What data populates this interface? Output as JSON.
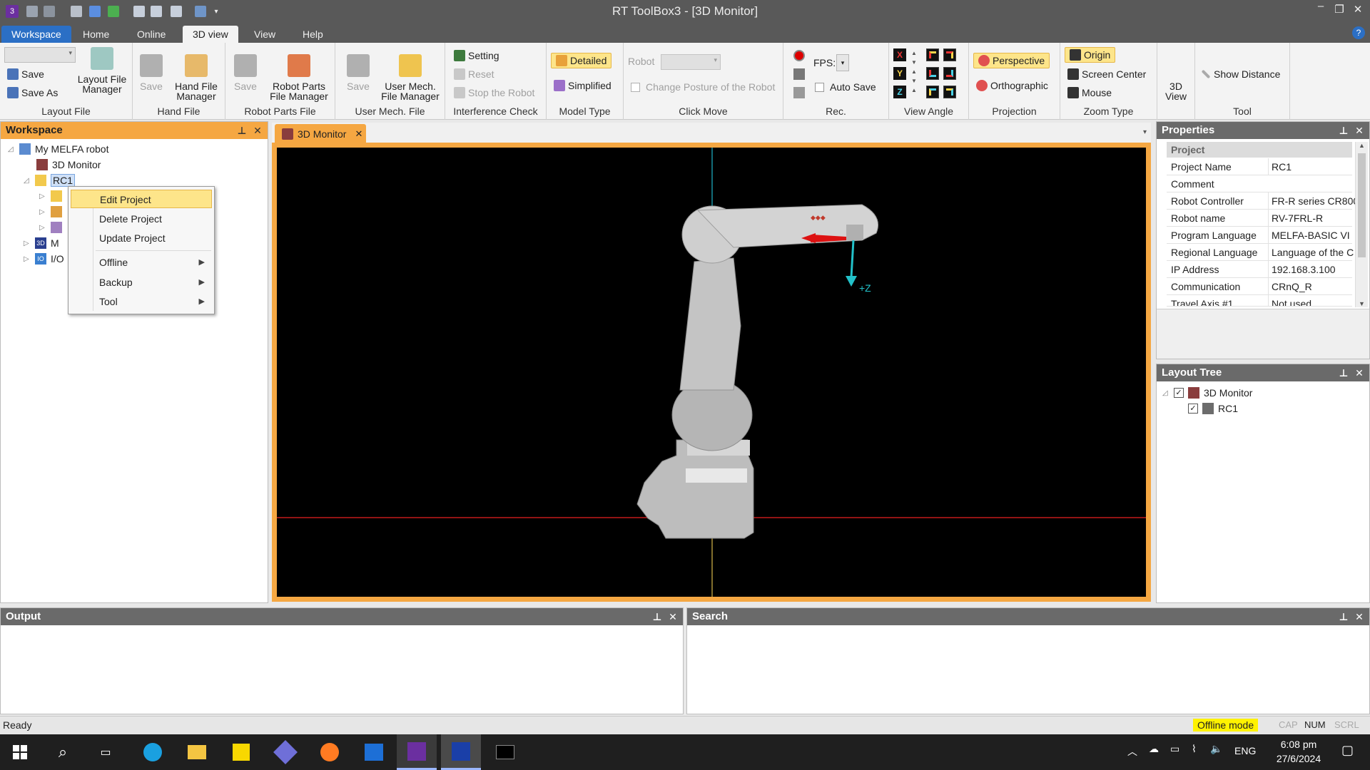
{
  "window": {
    "title": "RT ToolBox3 - [3D Monitor]"
  },
  "ribbon_tabs": [
    "Workspace",
    "Home",
    "Online",
    "3D view",
    "View",
    "Help"
  ],
  "ribbon": {
    "layout_file": {
      "save": "Save",
      "save_as": "Save As",
      "manager": "Layout File\nManager",
      "group": "Layout File"
    },
    "hand_file": {
      "save": "Save",
      "manager": "Hand File\nManager",
      "group": "Hand File"
    },
    "robot_parts": {
      "save": "Save",
      "manager": "Robot Parts\nFile Manager",
      "group": "Robot Parts File"
    },
    "user_mech": {
      "save": "Save",
      "manager": "User Mech.\nFile Manager",
      "group": "User Mech. File"
    },
    "interference": {
      "setting": "Setting",
      "reset": "Reset",
      "stop": "Stop the Robot",
      "group": "Interference Check"
    },
    "model_type": {
      "detailed": "Detailed",
      "simplified": "Simplified",
      "group": "Model Type"
    },
    "click_move": {
      "robot_label": "Robot",
      "change_posture": "Change Posture of the Robot",
      "group": "Click Move"
    },
    "rec": {
      "fps": "FPS:",
      "auto_save": "Auto Save",
      "group": "Rec."
    },
    "view_angle": {
      "x": "X",
      "y": "Y",
      "z": "Z",
      "group": "View Angle"
    },
    "projection": {
      "perspective": "Perspective",
      "orthographic": "Orthographic",
      "group": "Projection"
    },
    "zoom_type": {
      "origin": "Origin",
      "screen_center": "Screen Center",
      "mouse": "Mouse",
      "group": "Zoom Type"
    },
    "view3d": {
      "label": "3D\nView"
    },
    "tool": {
      "show_distance": "Show Distance",
      "group": "Tool"
    }
  },
  "workspace": {
    "title": "Workspace",
    "root": "My MELFA robot",
    "monitor": "3D Monitor",
    "project": "RC1",
    "item_m": "M",
    "item_io": "I/O"
  },
  "context_menu": {
    "items": [
      "Edit Project",
      "Delete Project",
      "Update Project",
      "Offline",
      "Backup",
      "Tool"
    ]
  },
  "document": {
    "tab": "3D Monitor",
    "axis_label": "+Z"
  },
  "properties": {
    "title": "Properties",
    "section": "Project",
    "rows": [
      {
        "k": "Project Name",
        "v": "RC1"
      },
      {
        "k": "Comment",
        "v": ""
      },
      {
        "k": "Robot Controller",
        "v": "FR-R series CR800-"
      },
      {
        "k": "Robot name",
        "v": "RV-7FRL-R"
      },
      {
        "k": "Program Language",
        "v": "MELFA-BASIC VI"
      },
      {
        "k": "Regional Language",
        "v": "Language of the C"
      },
      {
        "k": "IP Address",
        "v": "192.168.3.100"
      },
      {
        "k": "Communication",
        "v": "CRnQ_R"
      },
      {
        "k": "Travel Axis #1",
        "v": "Not used"
      }
    ]
  },
  "layout_tree": {
    "title": "Layout Tree",
    "root": "3D Monitor",
    "child": "RC1"
  },
  "output": {
    "title": "Output"
  },
  "search": {
    "title": "Search"
  },
  "status": {
    "ready": "Ready",
    "mode": "Offline mode",
    "cap": "CAP",
    "num": "NUM",
    "scrl": "SCRL"
  },
  "taskbar": {
    "lang": "ENG",
    "time": "6:08 pm",
    "date": "27/6/2024"
  },
  "colors": {
    "title_bg": "#595959",
    "workspace_tab": "#2b6fc5",
    "accent_orange": "#f5a742",
    "highlight": "#fde58a",
    "viewport": "#000000"
  }
}
